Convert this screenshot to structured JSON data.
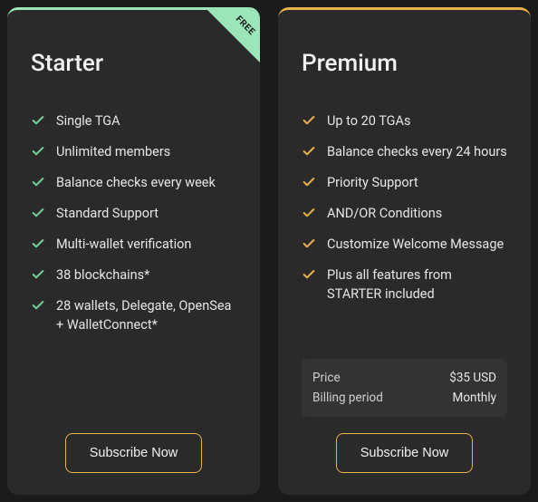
{
  "plans": {
    "starter": {
      "name": "Starter",
      "ribbon": "FREE",
      "features": [
        "Single TGA",
        "Unlimited members",
        "Balance checks every week",
        "Standard Support",
        "Multi-wallet verification",
        "38 blockchains*",
        "28 wallets, Delegate, OpenSea + WalletConnect*"
      ],
      "cta": "Subscribe Now"
    },
    "premium": {
      "name": "Premium",
      "features": [
        "Up to 20 TGAs",
        "Balance checks every 24 hours",
        "Priority Support",
        "AND/OR Conditions",
        "Customize Welcome Message",
        "Plus all features from STARTER included"
      ],
      "price": {
        "label": "Price",
        "value": "$35 USD",
        "period_label": "Billing period",
        "period_value": "Monthly"
      },
      "cta": "Subscribe Now"
    }
  }
}
